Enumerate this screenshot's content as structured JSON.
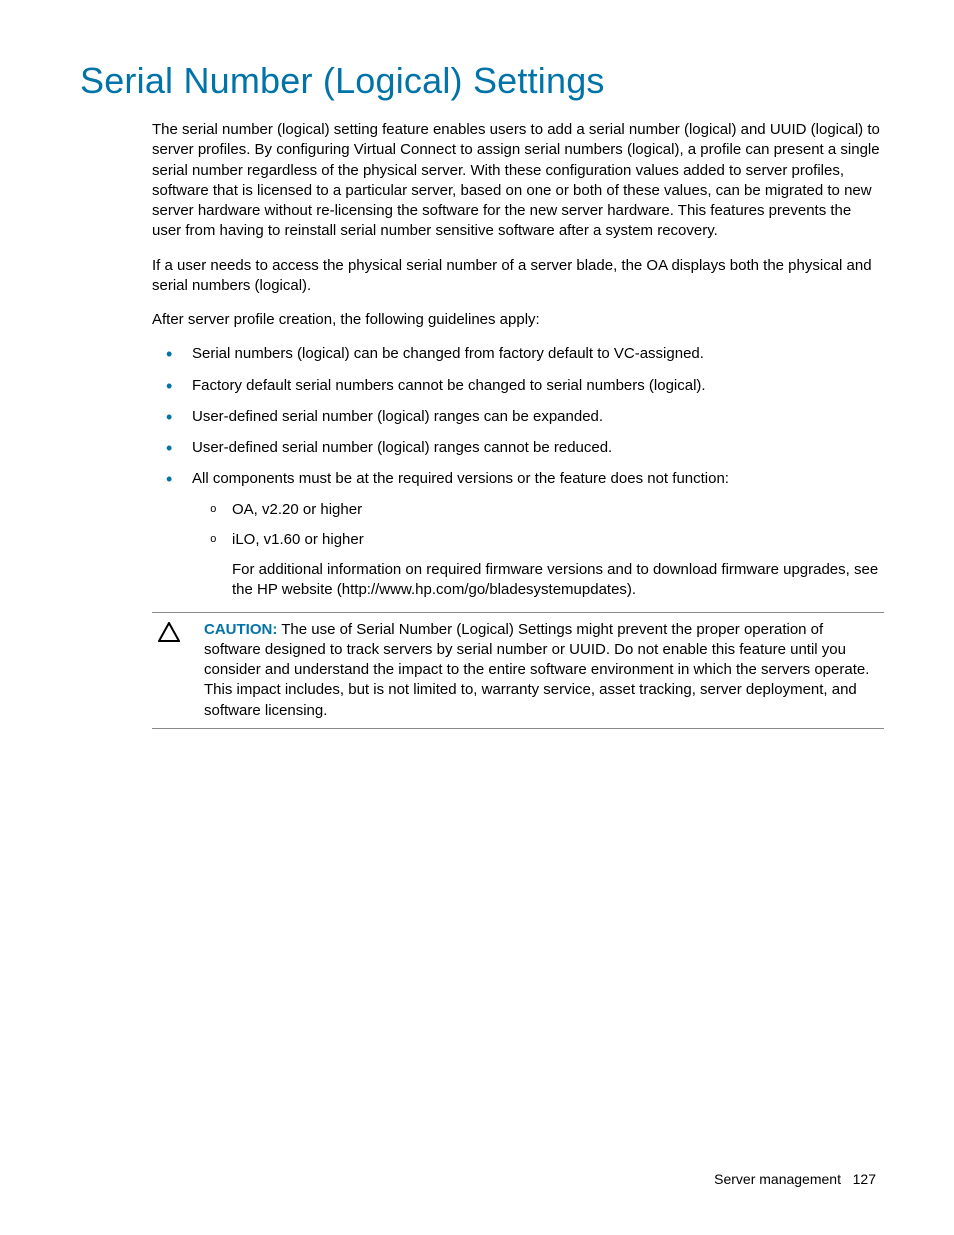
{
  "title": "Serial Number (Logical) Settings",
  "paragraphs": {
    "p1": "The serial number (logical) setting feature enables users to add a serial number (logical) and UUID (logical) to server profiles. By configuring Virtual Connect to assign serial numbers (logical), a profile can present a single serial number regardless of the physical server. With these configuration values added to server profiles, software that is licensed to a particular server, based on one or both of these values, can be migrated to new server hardware without re-licensing the software for the new server hardware. This features prevents the user from having to reinstall serial number sensitive software after a system recovery.",
    "p2": "If a user needs to access the physical serial number of a server blade, the OA displays both the physical and serial numbers (logical).",
    "p3": "After server profile creation, the following guidelines apply:"
  },
  "bullets": {
    "b1": "Serial numbers (logical) can be changed from factory default to VC-assigned.",
    "b2": "Factory default serial numbers cannot be changed to serial numbers (logical).",
    "b3": "User-defined serial number (logical) ranges can be expanded.",
    "b4": "User-defined serial number (logical) ranges cannot be reduced.",
    "b5": "All components must be at the required versions or the feature does not function:",
    "sub1": "OA, v2.20 or higher",
    "sub2": "iLO, v1.60 or higher",
    "sub_para": "For additional information on required firmware versions and to download firmware upgrades, see the HP website (http://www.hp.com/go/bladesystemupdates)."
  },
  "caution": {
    "label": "CAUTION:",
    "text": "  The use of Serial Number (Logical) Settings might prevent the proper operation of software designed to track servers by serial number or UUID. Do not enable this feature until you consider and understand the impact to the entire software environment in which the servers operate. This impact includes, but is not limited to, warranty service, asset tracking, server deployment, and software licensing."
  },
  "footer": {
    "section": "Server management",
    "page": "127"
  }
}
